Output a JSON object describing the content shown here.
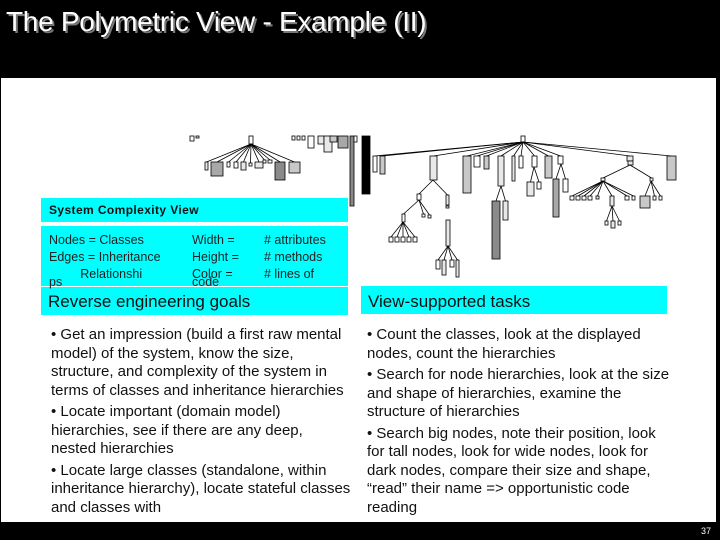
{
  "slide": {
    "title": "The Polymetric View - Example (II)",
    "page_number": "37"
  },
  "diagram": {
    "name": "System Complexity View",
    "legend": {
      "rows": [
        {
          "left": "Nodes = Classes",
          "mid": "Width =",
          "right": "# attributes"
        },
        {
          "left": "Edges = Inheritance",
          "mid": "Height =",
          "right": "# methods"
        },
        {
          "left": "         Relationshi",
          "mid": "Color =",
          "right": "# lines of"
        },
        {
          "left": "ps",
          "mid": "code",
          "right": ""
        }
      ]
    }
  },
  "goals": {
    "heading": "Reverse engineering goals",
    "items": [
      "• Get an impression (build a first raw mental model) of the system, know the size, structure, and complexity of the system in terms of classes and inheritance hierarchies",
      "• Locate important (domain model) hierarchies, see if there are any deep, nested hierarchies",
      "• Locate large classes (standalone, within inheritance hierarchy), locate stateful classes and classes with"
    ]
  },
  "tasks": {
    "heading": "View-supported tasks",
    "items": [
      "• Count the classes, look at the displayed nodes, count the hierarchies",
      "• Search for node hierarchies, look at the size and shape of hierarchies, examine the structure of hierarchies",
      "• Search big nodes, note their position, look for tall nodes, look for wide nodes, look for dark nodes, compare their size and shape, “read” their name => opportunistic code reading"
    ]
  },
  "colors": {
    "frame": "#000000",
    "highlight": "#00ffff",
    "node_fills": [
      "#ffffff",
      "#e8e8e8",
      "#c8c8c8",
      "#a8a8a8",
      "#8a8a8a",
      "#000000"
    ]
  }
}
